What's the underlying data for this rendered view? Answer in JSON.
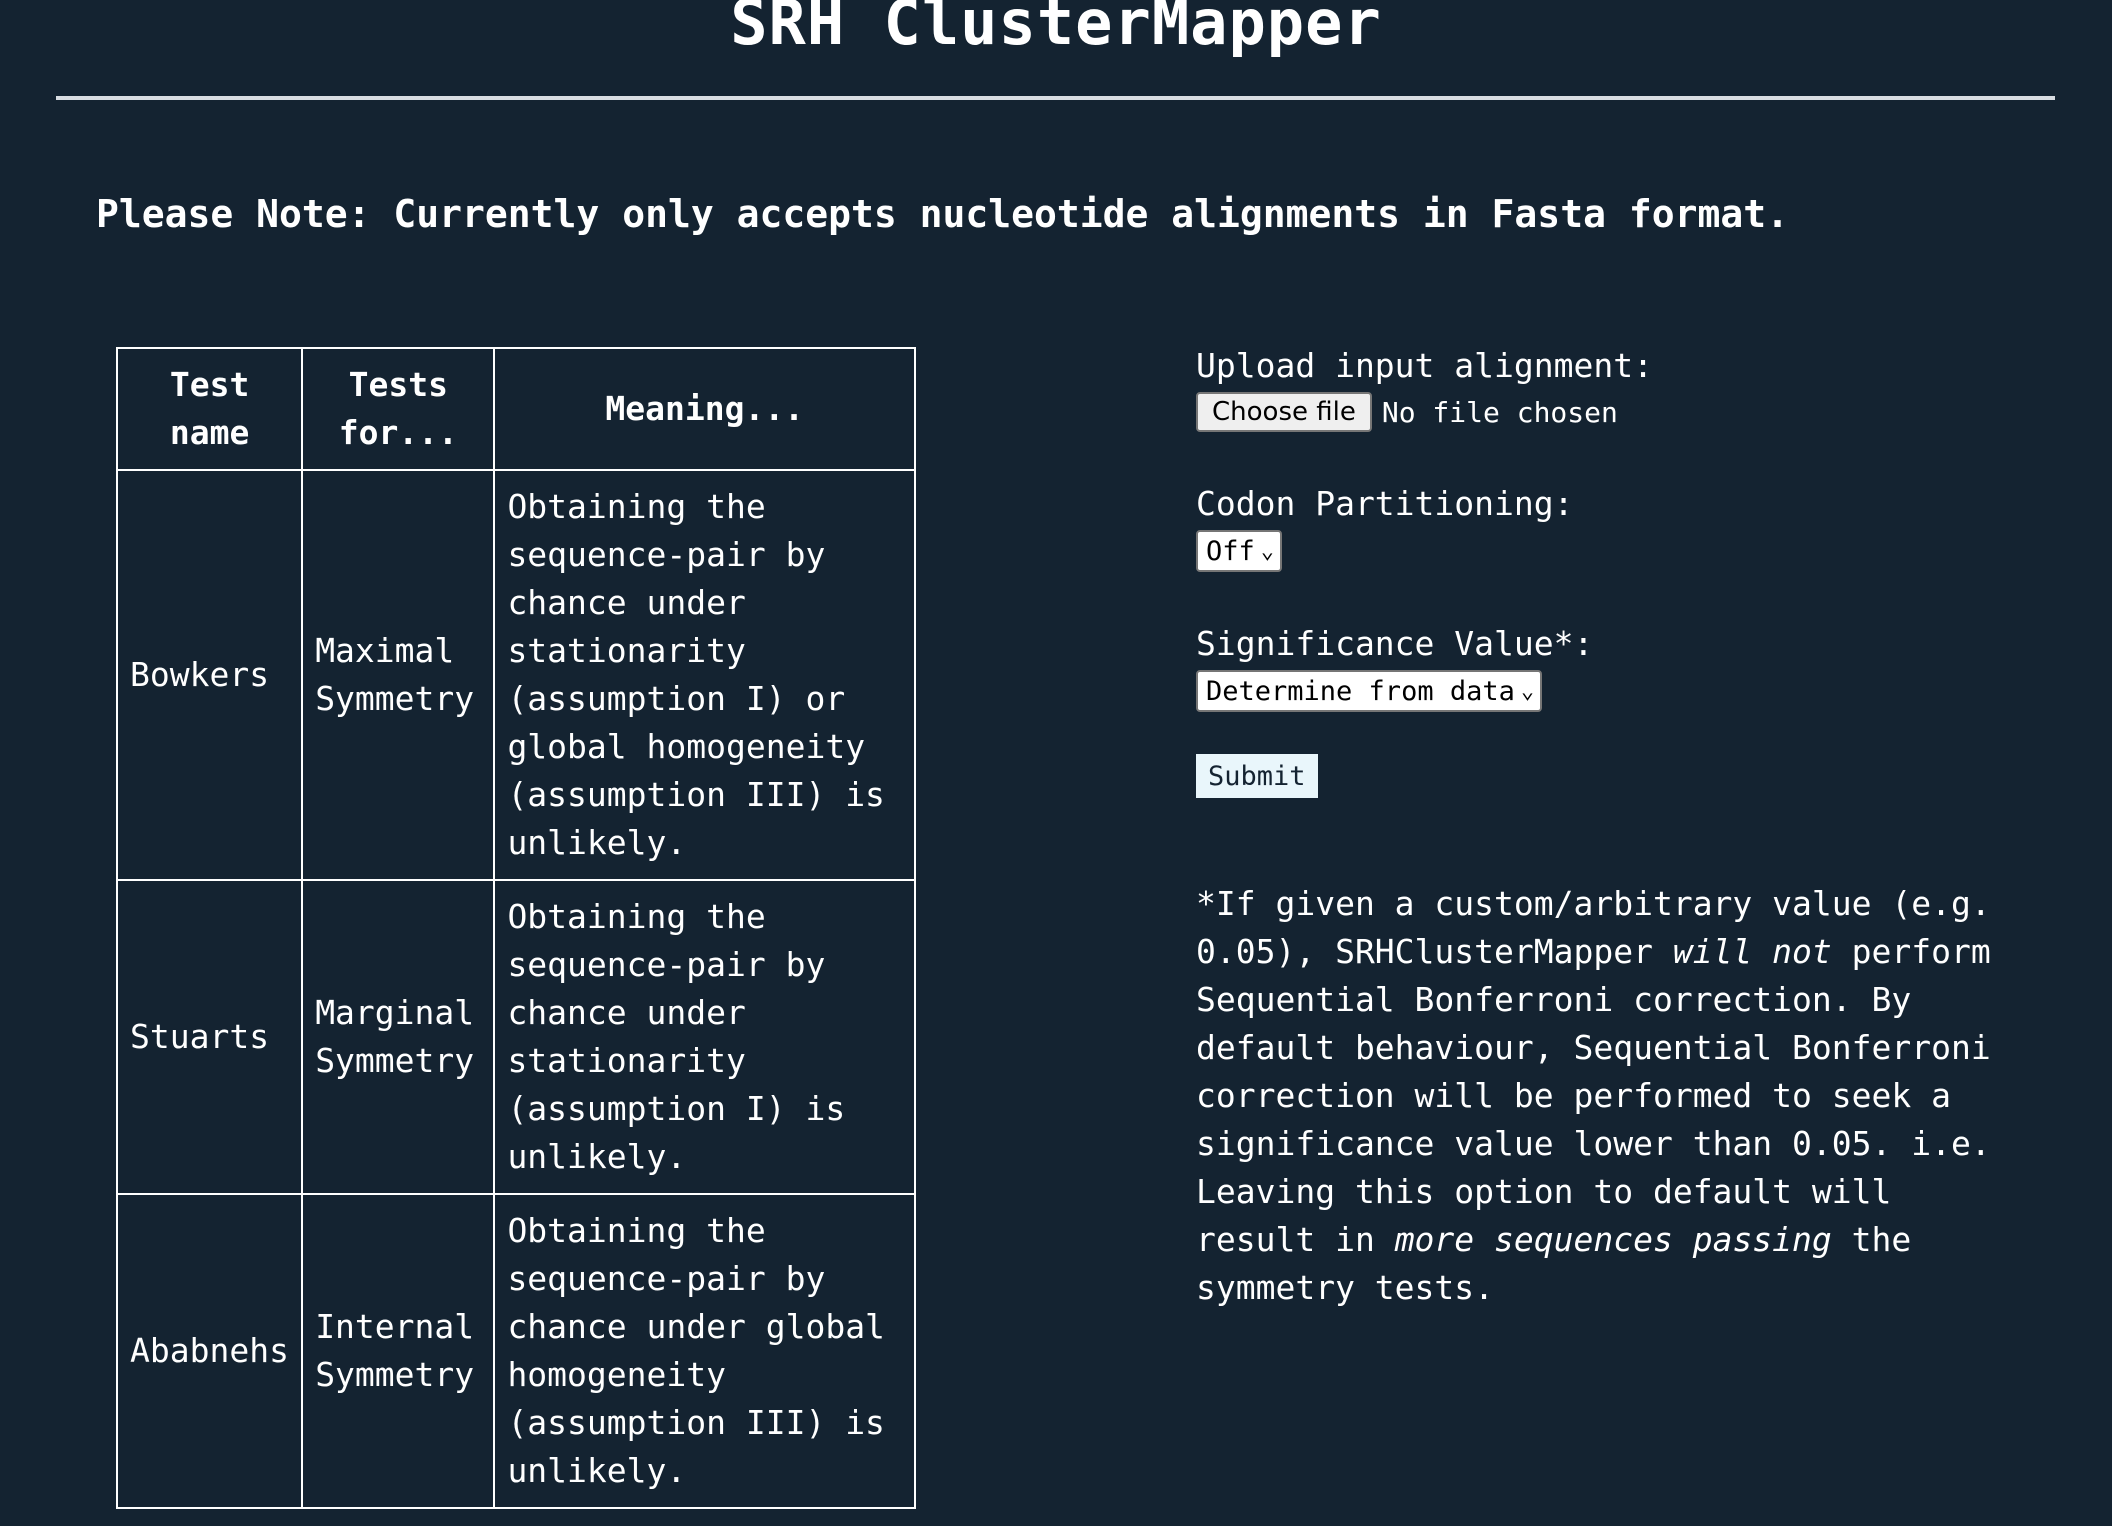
{
  "header": {
    "title": "SRH ClusterMapper",
    "note": "Please Note: Currently only accepts nucleotide alignments in Fasta format."
  },
  "table": {
    "headers": [
      "Test name",
      "Tests for...",
      "Meaning..."
    ],
    "rows": [
      {
        "name": "Bowkers",
        "tests_for": "Maximal Symmetry",
        "meaning": "Obtaining the sequence-pair by chance under stationarity (assumption I) or global homogeneity (assumption III) is unlikely."
      },
      {
        "name": "Stuarts",
        "tests_for": "Marginal Symmetry",
        "meaning": "Obtaining the sequence-pair by chance under stationarity (assumption I) is unlikely."
      },
      {
        "name": "Ababnehs",
        "tests_for": "Internal Symmetry",
        "meaning": "Obtaining the sequence-pair by chance under global homogeneity (assumption III) is unlikely."
      }
    ]
  },
  "form": {
    "upload_label": "Upload input alignment:",
    "choose_file": "Choose file",
    "file_status": "No file chosen",
    "codon_label": "Codon Partitioning:",
    "codon_value": "Off",
    "significance_label": "Significance Value*:",
    "significance_value": "Determine from data",
    "submit": "Submit"
  },
  "footnote": {
    "part1": "*If given a custom/arbitrary value (e.g. 0.05), SRHClusterMapper ",
    "em1": "will not",
    "part2": " perform Sequential Bonferroni correction. By default behaviour, Sequential Bonferroni correction will be performed to seek a significance value lower than 0.05. i.e. Leaving this option to default will result in ",
    "em2": "more sequences passing",
    "part3": " the symmetry tests."
  }
}
